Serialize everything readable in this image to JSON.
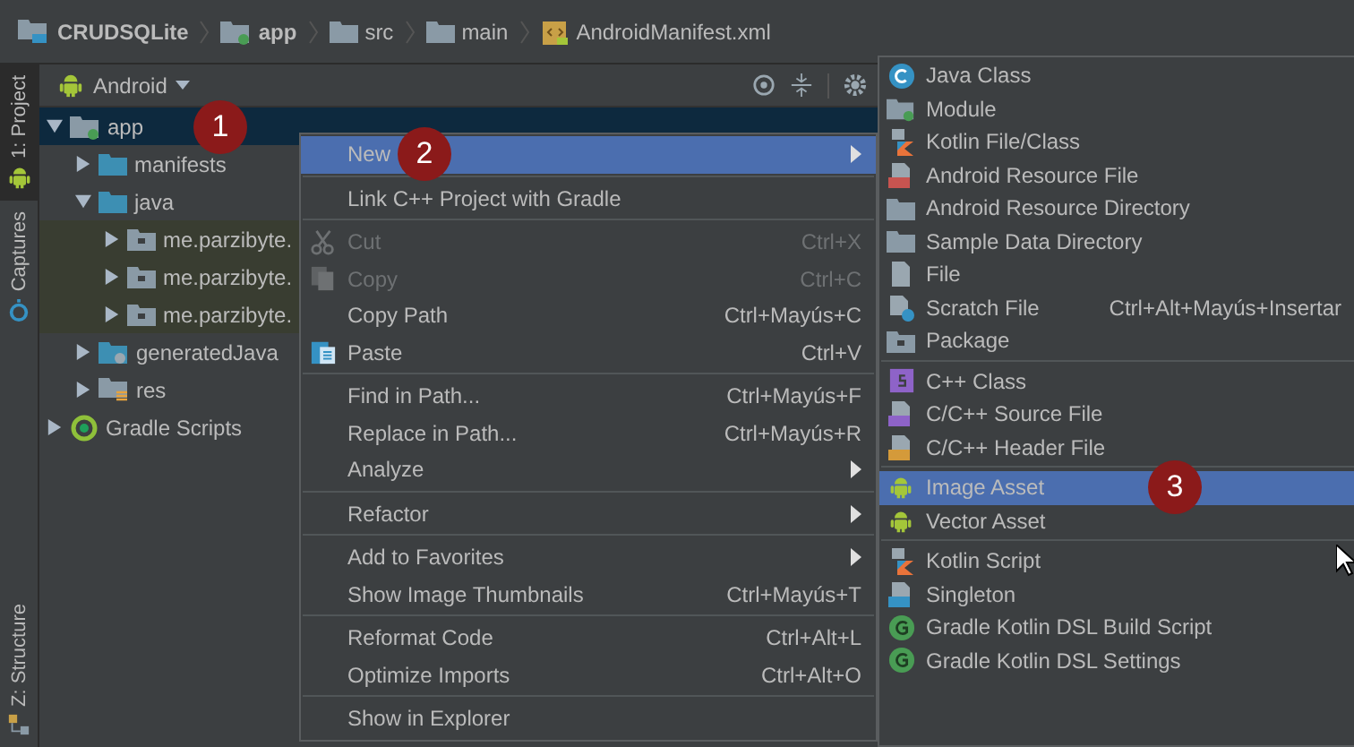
{
  "breadcrumb": [
    {
      "label": "CRUDSQLite",
      "kind": "project"
    },
    {
      "label": "app",
      "kind": "module"
    },
    {
      "label": "src",
      "kind": "folder"
    },
    {
      "label": "main",
      "kind": "folder"
    },
    {
      "label": "AndroidManifest.xml",
      "kind": "manifest"
    }
  ],
  "tool_strip": {
    "top": [
      {
        "label": "1: Project",
        "selected": true,
        "kind": "android"
      },
      {
        "label": "Captures",
        "selected": false,
        "kind": "capture"
      }
    ],
    "bottom": [
      {
        "label": "Z: Structure",
        "selected": false,
        "kind": "structure"
      }
    ]
  },
  "project_panel": {
    "view": "Android",
    "tree": [
      {
        "label": "app",
        "kind": "module",
        "expanded": true,
        "selected": true,
        "highlighted": false,
        "callout": "1",
        "children": [
          {
            "label": "manifests",
            "kind": "folder",
            "expanded": false,
            "selected": false,
            "highlighted": false
          },
          {
            "label": "java",
            "kind": "folder",
            "expanded": true,
            "selected": false,
            "highlighted": false,
            "children": [
              {
                "label": "me.parzibyte.",
                "kind": "package",
                "expanded": false,
                "selected": false,
                "highlighted": true
              },
              {
                "label": "me.parzibyte.",
                "kind": "package",
                "expanded": false,
                "selected": false,
                "highlighted": true
              },
              {
                "label": "me.parzibyte.",
                "kind": "package",
                "expanded": false,
                "selected": false,
                "highlighted": true
              }
            ]
          },
          {
            "label": "generatedJava",
            "kind": "generated",
            "expanded": false,
            "selected": false,
            "highlighted": false
          },
          {
            "label": "res",
            "kind": "res",
            "expanded": false,
            "selected": false,
            "highlighted": false
          }
        ]
      },
      {
        "label": "Gradle Scripts",
        "kind": "gradle",
        "expanded": false,
        "selected": false,
        "highlighted": false
      }
    ]
  },
  "context_menu": [
    [
      {
        "label": "New",
        "selected": true,
        "disabled": false,
        "submenu": true,
        "callout": "2"
      }
    ],
    [
      {
        "label": "Link C++ Project with Gradle",
        "selected": false,
        "disabled": false,
        "submenu": false
      }
    ],
    [
      {
        "label": "Cut",
        "shortcut": "Ctrl+X",
        "kind": "cut",
        "selected": false,
        "disabled": true,
        "submenu": false
      },
      {
        "label": "Copy",
        "shortcut": "Ctrl+C",
        "kind": "copy",
        "selected": false,
        "disabled": true,
        "submenu": false
      },
      {
        "label": "Copy Path",
        "shortcut": "Ctrl+Mayús+C",
        "selected": false,
        "disabled": false,
        "submenu": false
      },
      {
        "label": "Paste",
        "shortcut": "Ctrl+V",
        "kind": "paste",
        "selected": false,
        "disabled": false,
        "submenu": false
      }
    ],
    [
      {
        "label": "Find in Path...",
        "shortcut": "Ctrl+Mayús+F",
        "selected": false,
        "disabled": false,
        "submenu": false
      },
      {
        "label": "Replace in Path...",
        "shortcut": "Ctrl+Mayús+R",
        "selected": false,
        "disabled": false,
        "submenu": false
      },
      {
        "label": "Analyze",
        "selected": false,
        "disabled": false,
        "submenu": true
      }
    ],
    [
      {
        "label": "Refactor",
        "selected": false,
        "disabled": false,
        "submenu": true
      }
    ],
    [
      {
        "label": "Add to Favorites",
        "selected": false,
        "disabled": false,
        "submenu": true
      },
      {
        "label": "Show Image Thumbnails",
        "shortcut": "Ctrl+Mayús+T",
        "selected": false,
        "disabled": false,
        "submenu": false
      }
    ],
    [
      {
        "label": "Reformat Code",
        "shortcut": "Ctrl+Alt+L",
        "selected": false,
        "disabled": false,
        "submenu": false
      },
      {
        "label": "Optimize Imports",
        "shortcut": "Ctrl+Alt+O",
        "selected": false,
        "disabled": false,
        "submenu": false
      }
    ],
    [
      {
        "label": "Show in Explorer",
        "selected": false,
        "disabled": false,
        "submenu": false
      }
    ]
  ],
  "new_submenu": [
    [
      {
        "label": "Java Class",
        "kind": "class",
        "selected": false
      },
      {
        "label": "Module",
        "kind": "module",
        "selected": false
      },
      {
        "label": "Kotlin File/Class",
        "kind": "kotlin",
        "selected": false
      },
      {
        "label": "Android Resource File",
        "kind": "resfile",
        "selected": false
      },
      {
        "label": "Android Resource Directory",
        "kind": "folder",
        "selected": false
      },
      {
        "label": "Sample Data Directory",
        "kind": "folder",
        "selected": false
      },
      {
        "label": "File",
        "kind": "file",
        "selected": false
      },
      {
        "label": "Scratch File",
        "shortcut": "Ctrl+Alt+Mayús+Insertar",
        "kind": "scratch",
        "selected": false
      },
      {
        "label": "Package",
        "kind": "package",
        "selected": false
      }
    ],
    [
      {
        "label": "C++ Class",
        "kind": "cppclass",
        "selected": false
      },
      {
        "label": "C/C++ Source File",
        "kind": "cppsource",
        "selected": false
      },
      {
        "label": "C/C++ Header File",
        "kind": "cppheader",
        "selected": false
      }
    ],
    [
      {
        "label": "Image Asset",
        "kind": "android",
        "selected": true,
        "callout": "3"
      },
      {
        "label": "Vector Asset",
        "kind": "android",
        "selected": false
      }
    ],
    [
      {
        "label": "Kotlin Script",
        "kind": "kotlin",
        "selected": false
      },
      {
        "label": "Singleton",
        "kind": "singleton",
        "selected": false
      },
      {
        "label": "Gradle Kotlin DSL Build Script",
        "kind": "gradlek",
        "selected": false
      },
      {
        "label": "Gradle Kotlin DSL Settings",
        "kind": "gradlek",
        "selected": false
      }
    ]
  ]
}
